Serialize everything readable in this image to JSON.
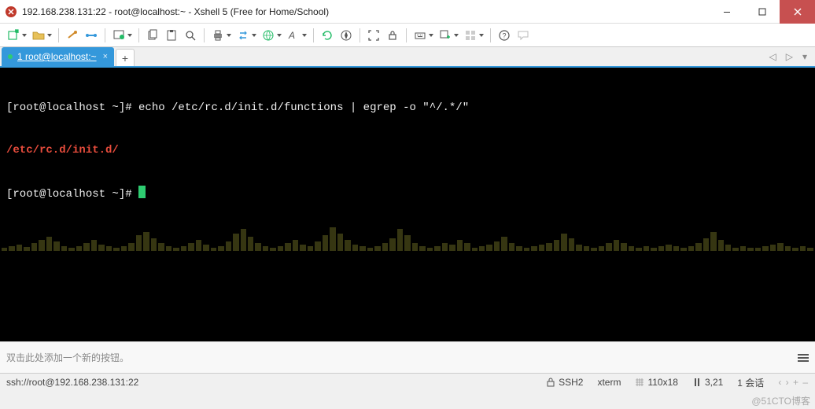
{
  "window": {
    "title": "192.168.238.131:22 - root@localhost:~ - Xshell 5 (Free for Home/School)"
  },
  "tabs": {
    "active_label": "1 root@localhost:~"
  },
  "terminal": {
    "line1": "[root@localhost ~]# echo /etc/rc.d/init.d/functions | egrep -o \"^/.*/\"",
    "line2": "/etc/rc.d/init.d/",
    "line3": "[root@localhost ~]# "
  },
  "lower_panel": {
    "hint": "双击此处添加一个新的按钮。"
  },
  "statusbar": {
    "ssh_target": "ssh://root@192.168.238.131:22",
    "protocol": "SSH2",
    "term_type": "xterm",
    "geometry": "110x18",
    "cursor": "3,21",
    "session_label": "1 会话"
  },
  "watermark": "@51CTO博客"
}
